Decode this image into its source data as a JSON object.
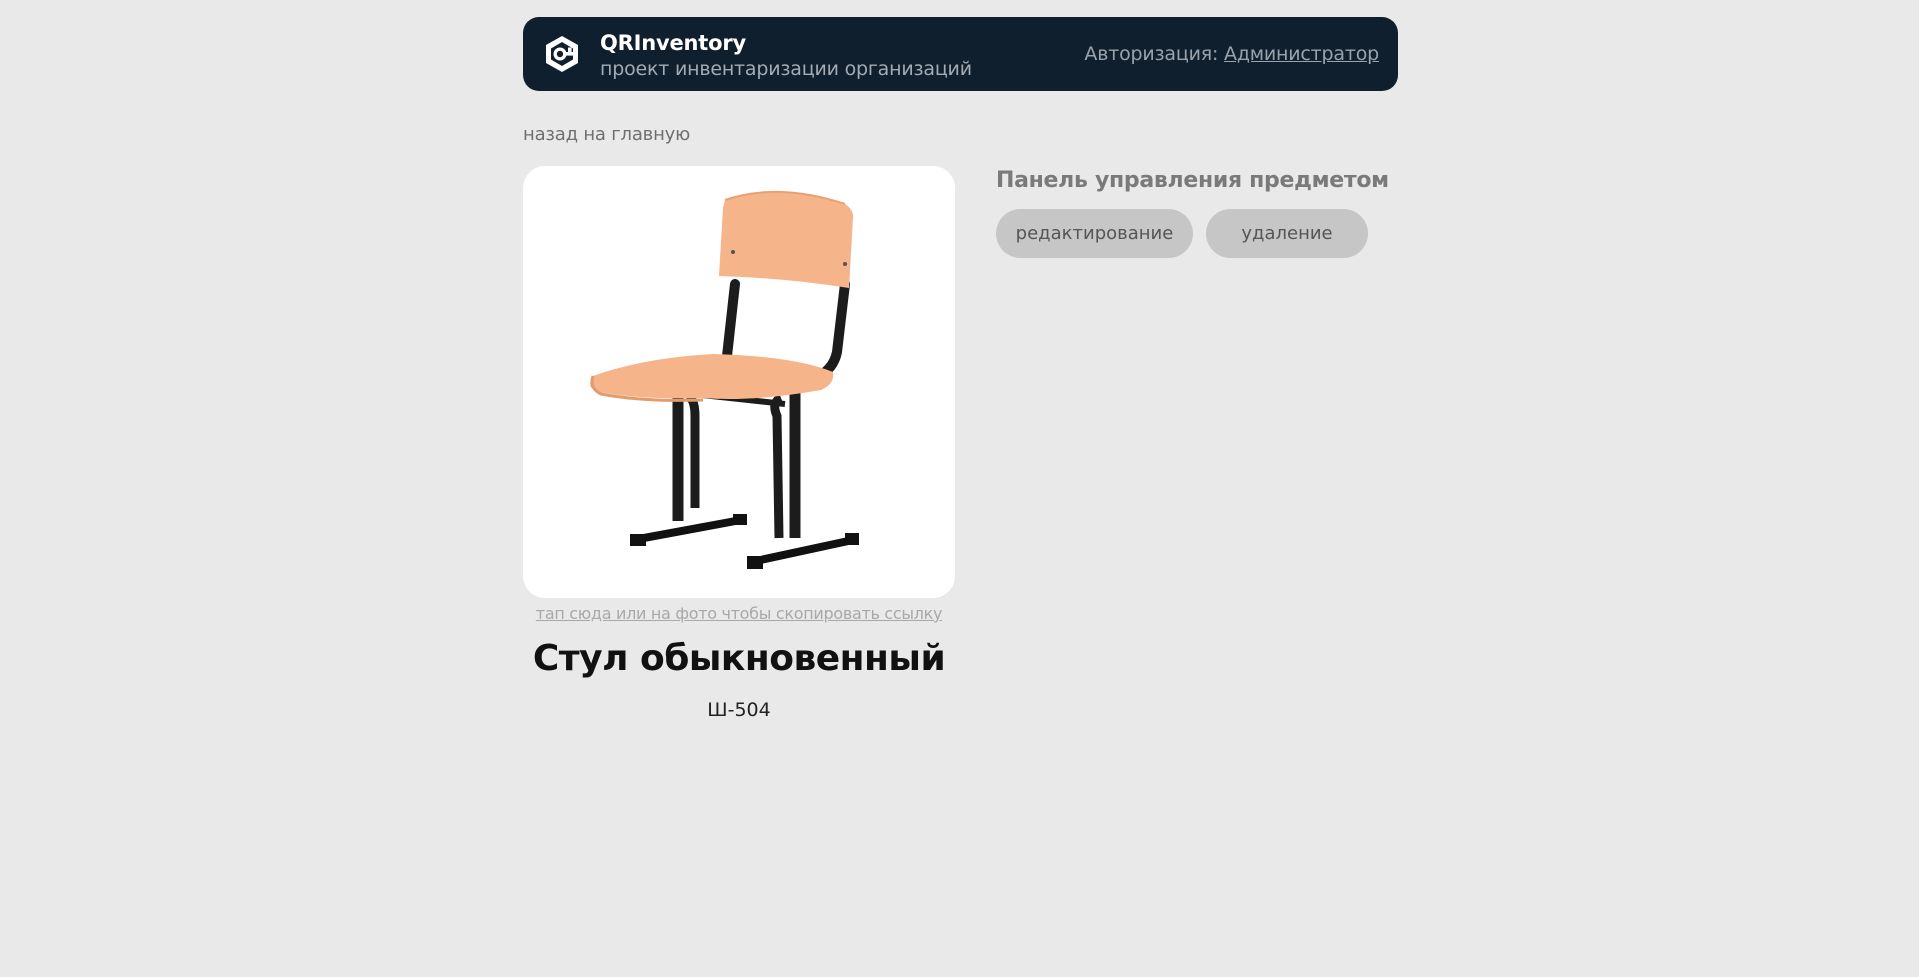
{
  "header": {
    "app_name": "QRInventory",
    "subtitle": "проект инвентаризации организаций",
    "auth_label": "Авторизация: ",
    "auth_user": "Администратор",
    "logo_icon": "qr-key-logo-icon"
  },
  "nav": {
    "back_label": "назад на главную"
  },
  "item": {
    "photo_alt": "Стул обыкновенный",
    "copy_hint": "тап сюда или на фото чтобы скопировать ссылку",
    "title": "Стул обыкновенный",
    "code": "Ш-504"
  },
  "control_panel": {
    "title": "Панель управления предметом",
    "edit_label": "редактирование",
    "delete_label": "удаление"
  },
  "colors": {
    "background": "#e9e9e9",
    "header_bg": "#0f1f2e",
    "button_bg": "#c6c6c6",
    "card_bg": "#ffffff"
  }
}
